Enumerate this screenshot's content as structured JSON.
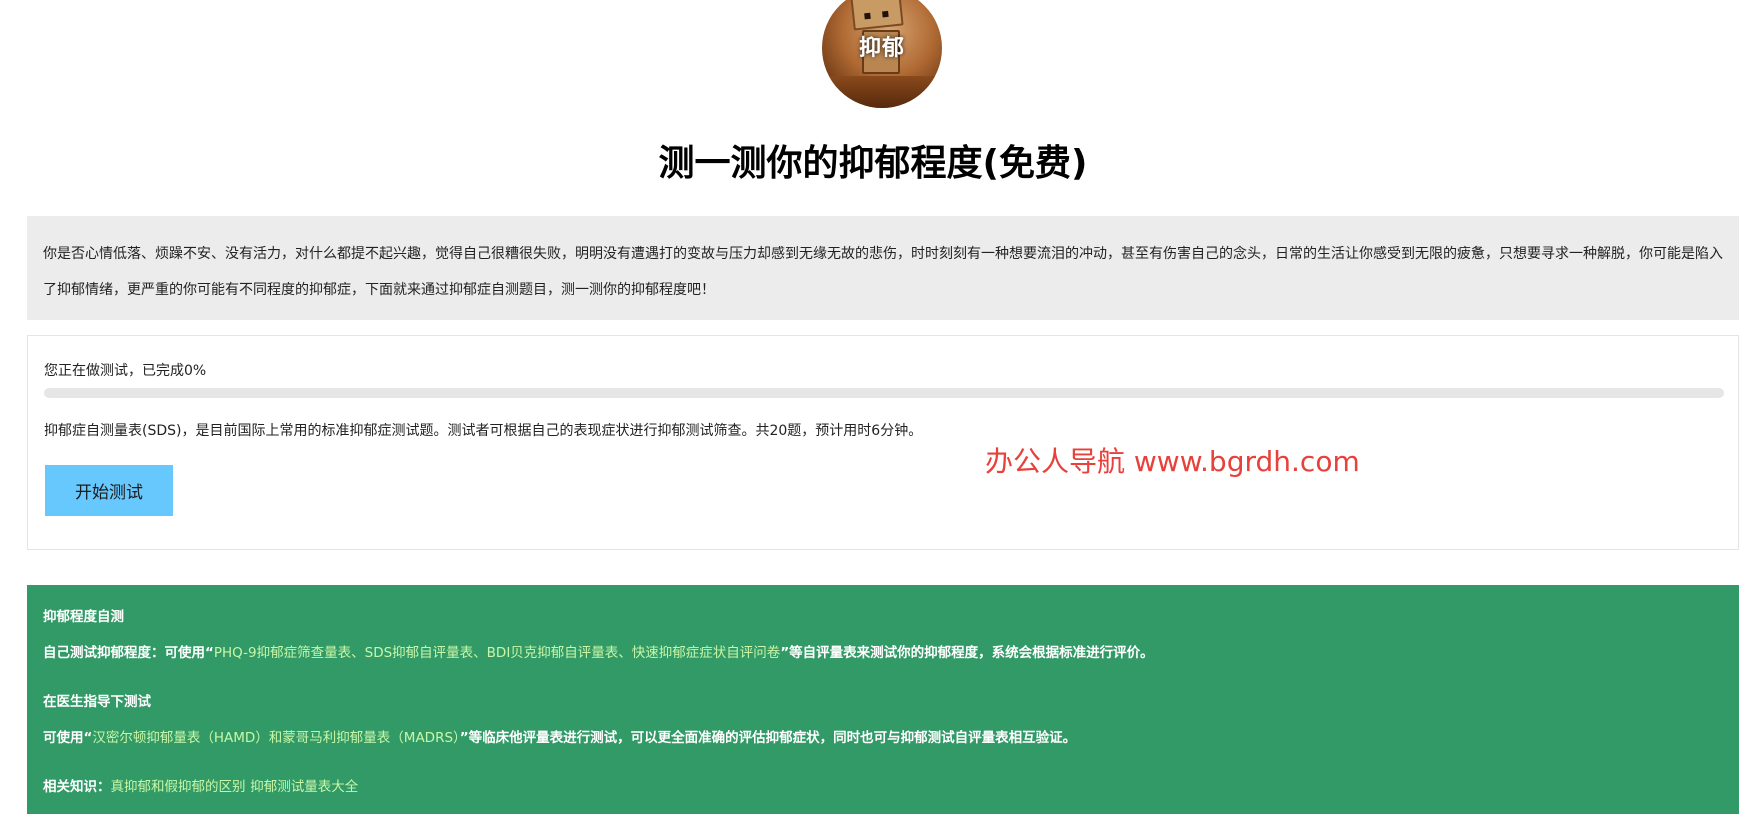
{
  "avatar": {
    "text": "抑郁"
  },
  "title": "测一测你的抑郁程度(免费)",
  "intro": {
    "text": "你是否心情低落、烦躁不安、没有活力，对什么都提不起兴趣，觉得自己很糟很失败，明明没有遭遇打的变故与压力却感到无缘无故的悲伤，时时刻刻有一种想要流泪的冲动，甚至有伤害自己的念头，日常的生活让你感受到无限的疲惫，只想要寻求一种解脱，你可能是陷入了抑郁情绪，更严重的你可能有不同程度的抑郁症，下面就来通过抑郁症自测题目，测一测你的抑郁程度吧！"
  },
  "test": {
    "progress_text": "您正在做测试，已完成0%",
    "progress_value": 0,
    "description": "抑郁症自测量表(SDS)，是目前国际上常用的标准抑郁症测试题。测试者可根据自己的表现症状进行抑郁测试筛查。共20题，预计用时6分钟。",
    "start_label": "开始测试"
  },
  "watermark": "办公人导航 www.bgrdh.com",
  "info": {
    "section1_title": "抑郁程度自测",
    "section1_prefix": "自己测试抑郁程度：可使用“",
    "section1_highlight": "PHQ-9抑郁症筛查量表、SDS抑郁自评量表、BDI贝克抑郁自评量表、快速抑郁症症状自评问卷",
    "section1_suffix": "”等自评量表来测试你的抑郁程度，系统会根据标准进行评价。",
    "section2_title": "在医生指导下测试",
    "section2_prefix": "可使用“",
    "section2_highlight": "汉密尔顿抑郁量表（HAMD）和蒙哥马利抑郁量表（MADRS）",
    "section2_suffix": "”等临床他评量表进行测试，可以更全面准确的评估抑郁症状，同时也可与抑郁测试自评量表相互验证。",
    "related_label": "相关知识：",
    "related_links": [
      "真抑郁和假抑郁的区别",
      "抑郁测试量表大全"
    ]
  },
  "colors": {
    "progress_fill": "#6ecbff",
    "button_bg": "#66c8fd",
    "green_bg": "#329a67",
    "watermark": "#e8403a"
  }
}
